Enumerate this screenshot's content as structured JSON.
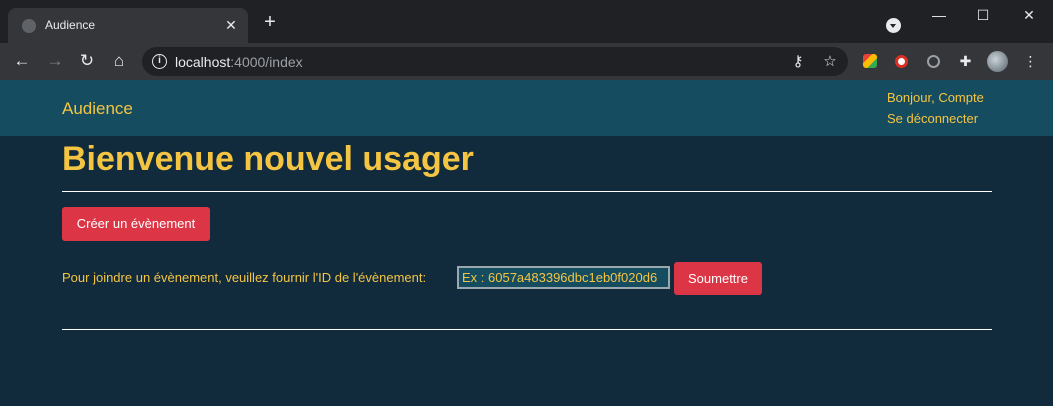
{
  "browser": {
    "tab_title": "Audience",
    "new_tab_symbol": "+",
    "window_controls": {
      "minimize": "—",
      "maximize": "☐",
      "close": "✕"
    },
    "url_host": "localhost",
    "url_path": ":4000/index",
    "icons": [
      "back-icon",
      "forward-icon",
      "reload-icon",
      "home-icon",
      "site-info-icon",
      "key-icon",
      "star-icon",
      "extensions-icon",
      "menu-icon"
    ]
  },
  "navbar": {
    "brand": "Audience",
    "greeting": "Bonjour, Compte",
    "logout": "Se déconnecter"
  },
  "main": {
    "title": "Bienvenue nouvel usager",
    "create_button": "Créer un évènement",
    "join_label": "Pour joindre un évènement, veuillez fournir l'ID de l'évènement:",
    "event_id_placeholder": "Ex : 6057a483396dbc1eb0f020d6",
    "submit_button": "Soumettre"
  },
  "colors": {
    "page_bg": "#112a3c",
    "navbar_bg": "#164c5f",
    "accent_text": "#f4c542",
    "button_red": "#dc3545"
  }
}
